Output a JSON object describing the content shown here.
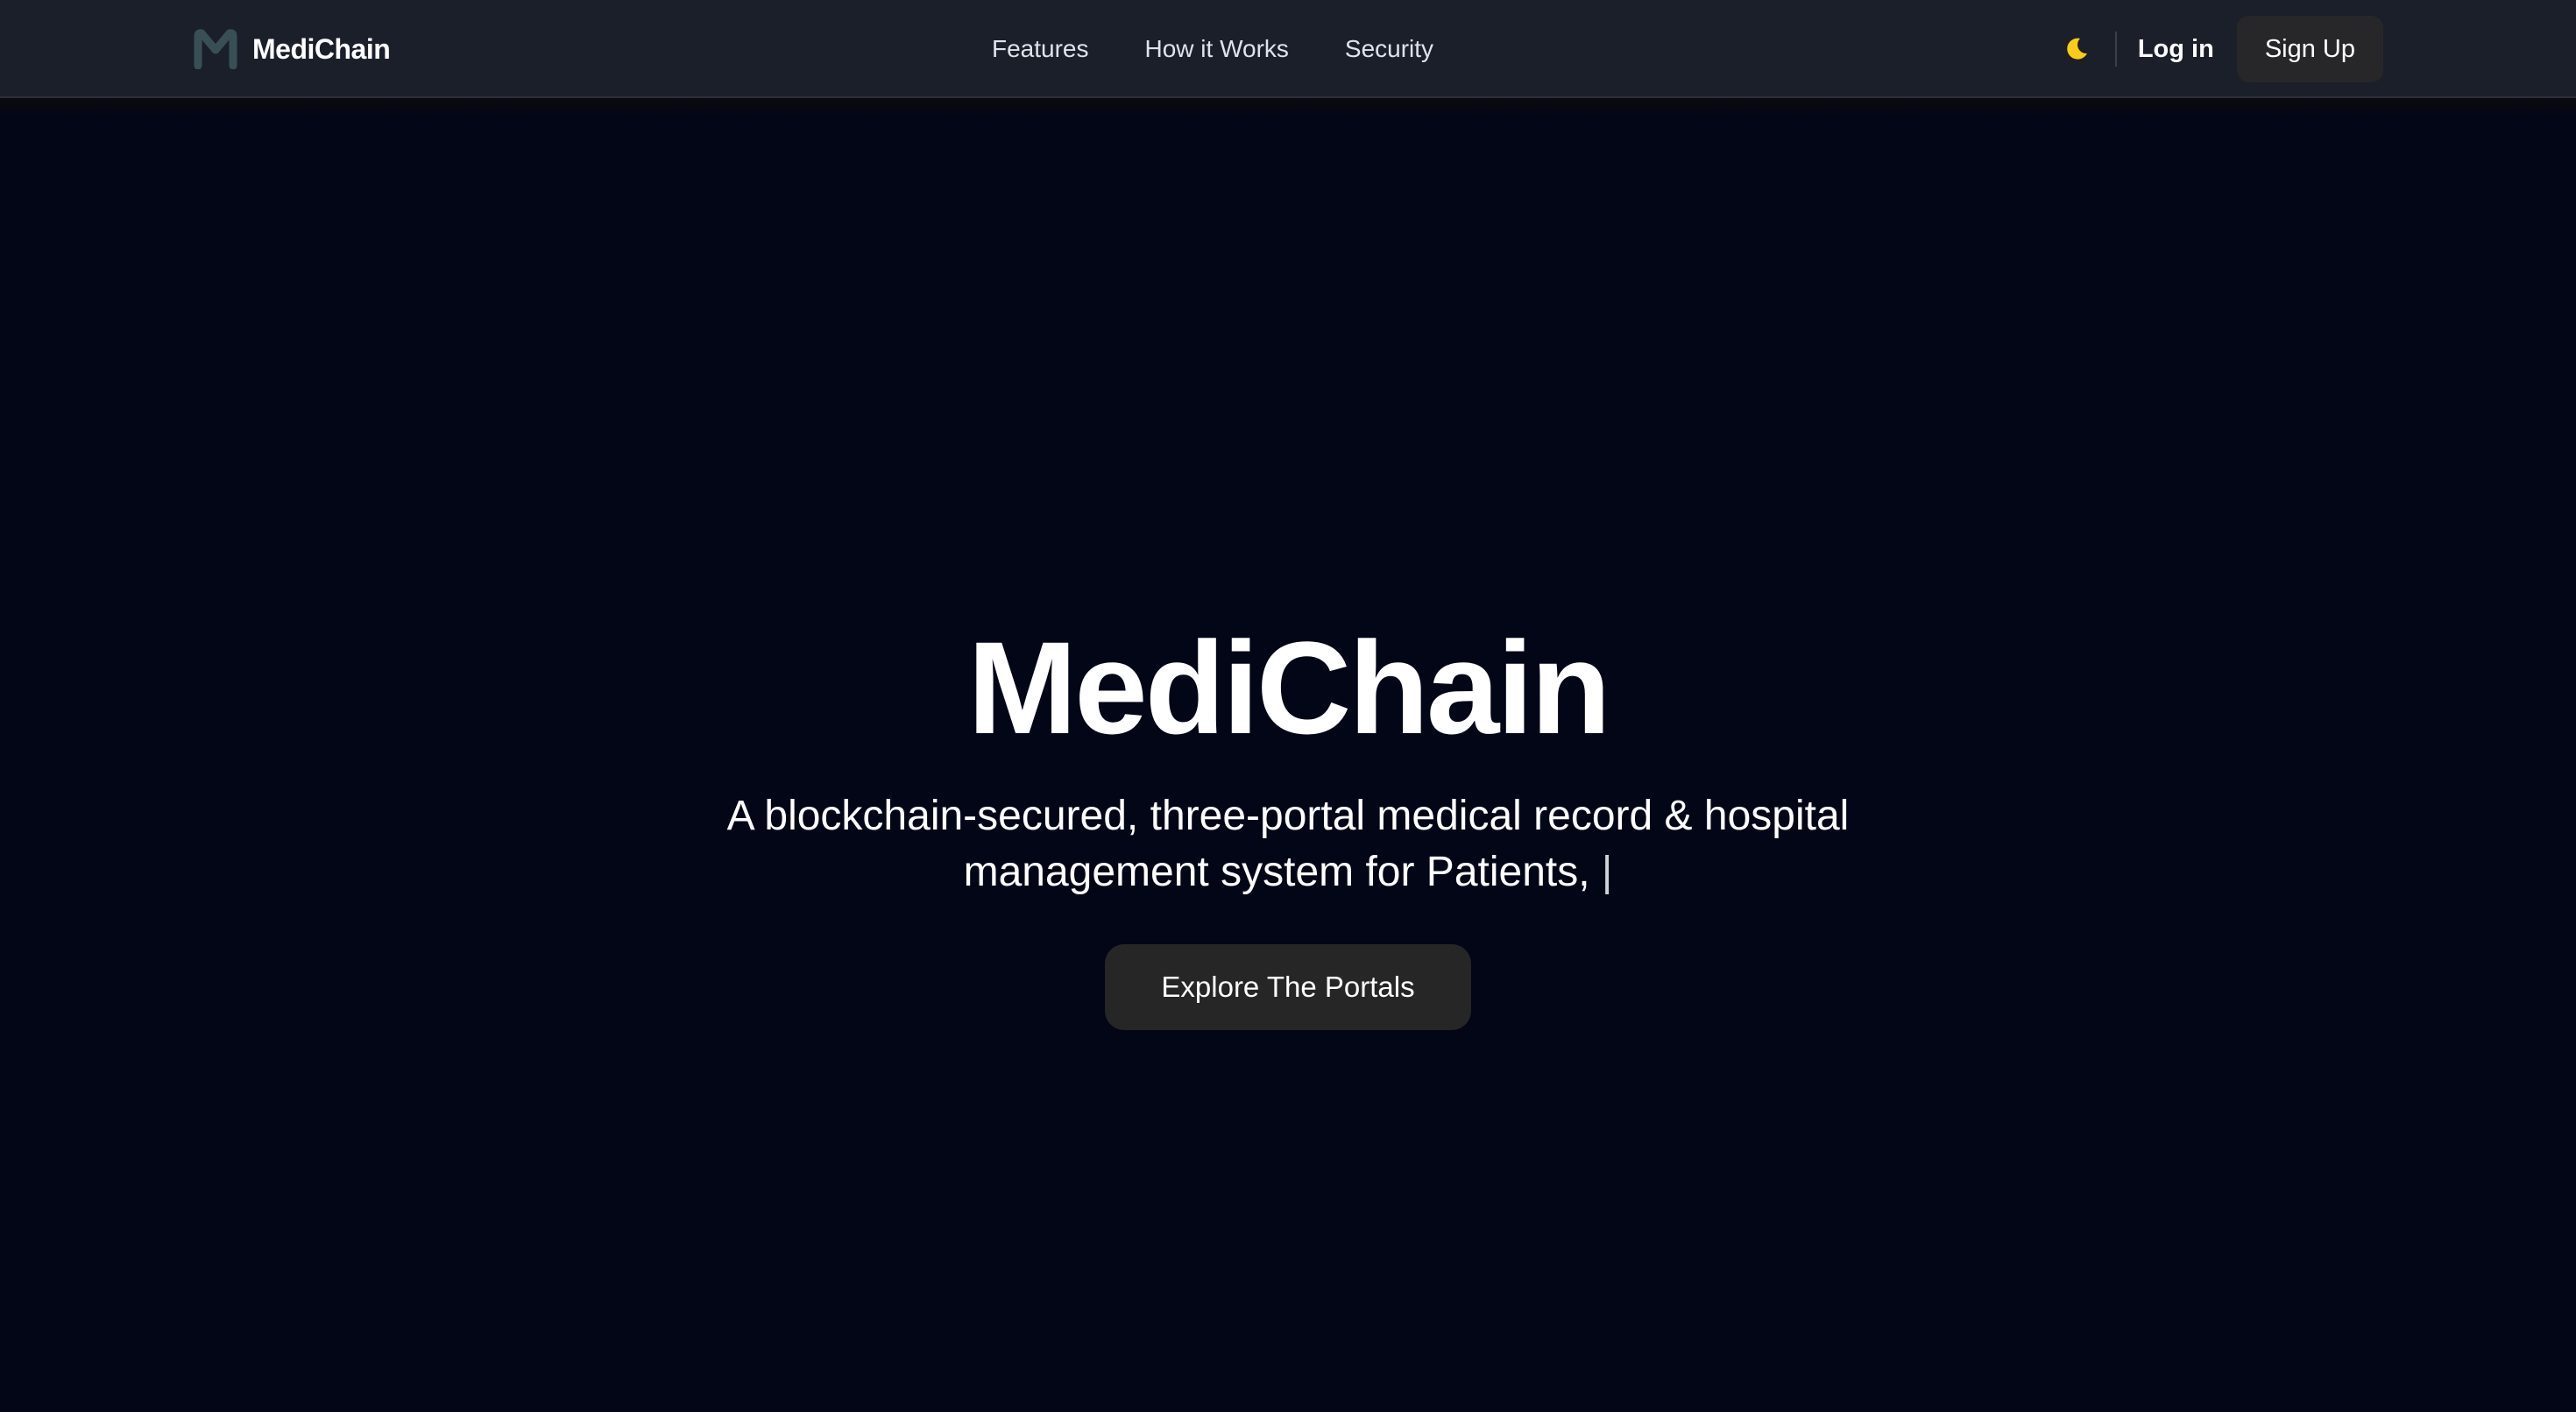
{
  "brand": {
    "name": "MediChain",
    "logo_icon": "medichain-m-logo-icon",
    "logo_color": "#3a4f55"
  },
  "nav": {
    "links": [
      {
        "label": "Features"
      },
      {
        "label": "How it Works"
      },
      {
        "label": "Security"
      }
    ],
    "theme_icon": "moon-icon",
    "theme_icon_color": "#facc15",
    "login_label": "Log in",
    "signup_label": "Sign Up"
  },
  "hero": {
    "title": "MediChain",
    "subtitle_line1": "A blockchain-secured, three-portal medical record & hospital",
    "subtitle_line2": "management system for Patients,",
    "cursor": "|",
    "cta_label": "Explore The Portals"
  },
  "colors": {
    "page_background": "#030617",
    "navbar_background": "#1a1f2a",
    "button_background": "#27272a"
  }
}
